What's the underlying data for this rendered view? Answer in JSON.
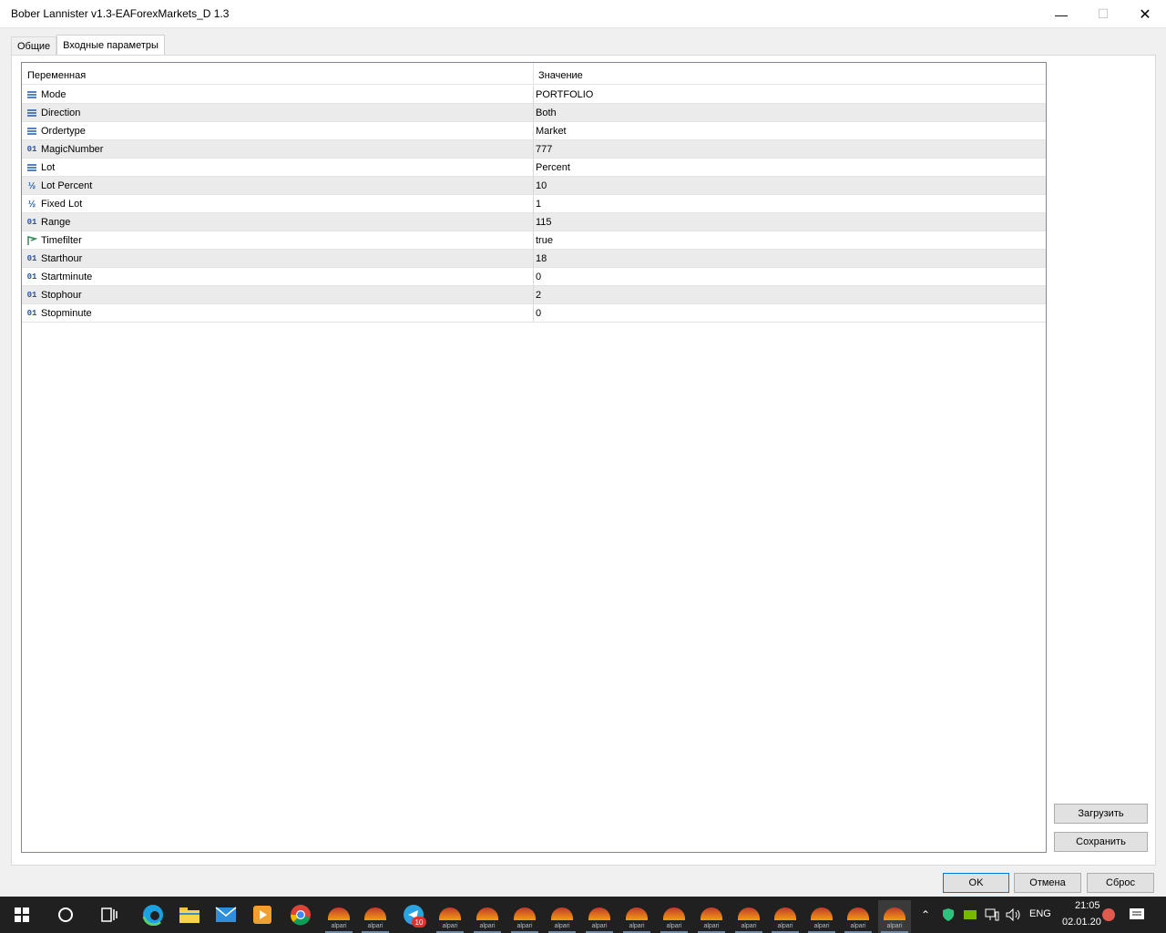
{
  "window": {
    "title": "Bober Lannister v1.3-EAForexMarkets_D 1.3"
  },
  "tabs": [
    {
      "label": "Общие"
    },
    {
      "label": "Входные параметры"
    }
  ],
  "grid": {
    "col_variable": "Переменная",
    "col_value": "Значение",
    "rows": [
      {
        "icon": "enum-icon",
        "name": "Mode",
        "value": "PORTFOLIO"
      },
      {
        "icon": "enum-icon",
        "name": "Direction",
        "value": "Both"
      },
      {
        "icon": "enum-icon",
        "name": "Ordertype",
        "value": "Market"
      },
      {
        "icon": "int-icon",
        "name": "MagicNumber",
        "value": "777"
      },
      {
        "icon": "enum-icon",
        "name": "Lot",
        "value": "Percent"
      },
      {
        "icon": "double-icon",
        "name": "Lot Percent",
        "value": "10"
      },
      {
        "icon": "double-icon",
        "name": "Fixed Lot",
        "value": "1"
      },
      {
        "icon": "int-icon",
        "name": "Range",
        "value": "115"
      },
      {
        "icon": "bool-icon",
        "name": "Timefilter",
        "value": "true"
      },
      {
        "icon": "int-icon",
        "name": "Starthour",
        "value": "18"
      },
      {
        "icon": "int-icon",
        "name": "Startminute",
        "value": "0"
      },
      {
        "icon": "int-icon",
        "name": "Stophour",
        "value": "2"
      },
      {
        "icon": "int-icon",
        "name": "Stopminute",
        "value": "0"
      }
    ]
  },
  "buttons": {
    "load": "Загрузить",
    "save": "Сохранить",
    "ok": "OK",
    "cancel": "Отмена",
    "reset": "Сброс"
  },
  "taskbar": {
    "alpari_label": "alpari",
    "telegram_badge": "10",
    "lang": "ENG",
    "time": "21:05",
    "date": "02.01.20"
  }
}
